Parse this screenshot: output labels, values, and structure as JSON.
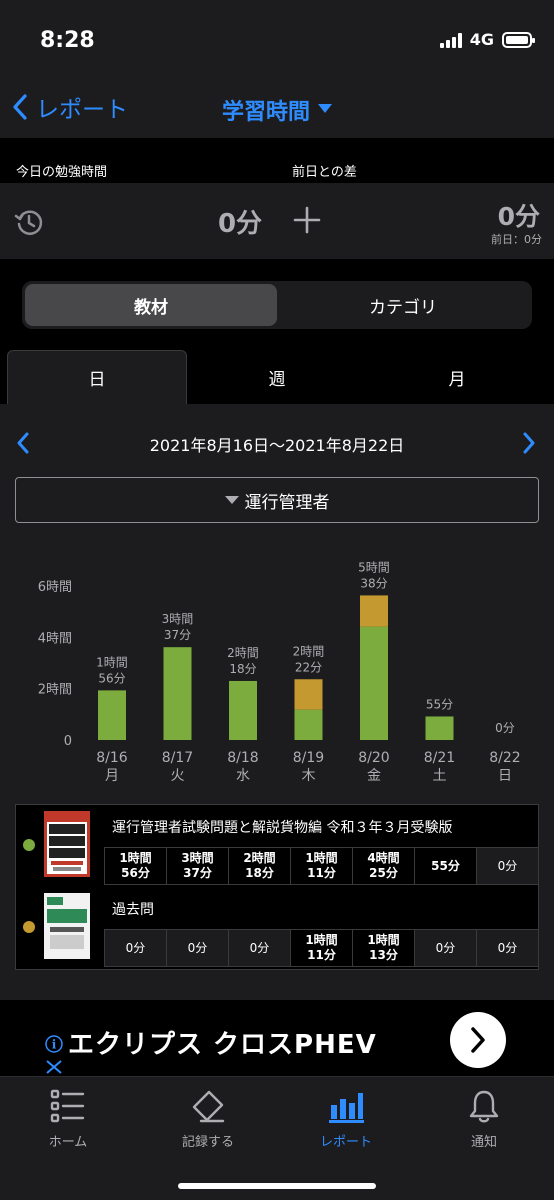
{
  "status": {
    "time": "8:28",
    "network": "4G"
  },
  "nav": {
    "back_label": "レポート",
    "title": "学習時間"
  },
  "summary": {
    "today_label": "今日の勉強時間",
    "diff_label": "前日との差",
    "today_value": "0分",
    "diff_value": "0分",
    "prev_value": "前日：0分"
  },
  "segment": {
    "materials": "教材",
    "category": "カテゴリ"
  },
  "tabs": {
    "day": "日",
    "week": "週",
    "month": "月"
  },
  "range": "2021年8月16日〜2021年8月22日",
  "filter": "運行管理者",
  "chart_data": {
    "type": "bar",
    "stacked": true,
    "categories": [
      "8/16",
      "8/17",
      "8/18",
      "8/19",
      "8/20",
      "8/21",
      "8/22"
    ],
    "weekdays": [
      "月",
      "火",
      "水",
      "木",
      "金",
      "土",
      "日"
    ],
    "series": [
      {
        "color": "#7cab3e",
        "values": [
          116,
          217,
          138,
          71,
          265,
          55,
          0
        ]
      },
      {
        "color": "#c49a30",
        "values": [
          0,
          0,
          0,
          71,
          73,
          0,
          0
        ]
      }
    ],
    "totals_label": [
      [
        "1時間",
        "56分"
      ],
      [
        "3時間",
        "37分"
      ],
      [
        "2時間",
        "18分"
      ],
      [
        "2時間",
        "22分"
      ],
      [
        "5時間",
        "38分"
      ],
      [
        "",
        "55分"
      ],
      [
        "",
        "0分"
      ]
    ],
    "y_ticks": [
      {
        "value": 0,
        "label": "0"
      },
      {
        "value": 120,
        "label": "2時間"
      },
      {
        "value": 240,
        "label": "4時間"
      },
      {
        "value": 360,
        "label": "6時間"
      }
    ],
    "ylim": [
      0,
      360
    ],
    "unit": "minutes"
  },
  "materials": [
    {
      "title": "運行管理者試験問題と解説貨物編 令和３年３月受験版",
      "color": "#7cab3e",
      "cells": [
        [
          "1時間",
          "56分"
        ],
        [
          "3時間",
          "37分"
        ],
        [
          "2時間",
          "18分"
        ],
        [
          "1時間",
          "11分"
        ],
        [
          "4時間",
          "25分"
        ],
        [
          "",
          "55分"
        ],
        [
          "",
          "0分"
        ]
      ],
      "highlight": [
        true,
        true,
        true,
        true,
        true,
        true,
        false
      ],
      "thumb_text": [
        "運行",
        "管理者",
        "試験",
        "問題と解説"
      ]
    },
    {
      "title": "過去問",
      "color": "#c49a30",
      "cells": [
        [
          "",
          "0分"
        ],
        [
          "",
          "0分"
        ],
        [
          "",
          "0分"
        ],
        [
          "1時間",
          "11分"
        ],
        [
          "1時間",
          "13分"
        ],
        [
          "",
          "0分"
        ],
        [
          "",
          "0分"
        ]
      ],
      "highlight": [
        false,
        false,
        false,
        true,
        true,
        false,
        false
      ]
    }
  ],
  "ad": {
    "text": "エクリプス クロスPHEV"
  },
  "tabbar": {
    "home": "ホーム",
    "record": "記録する",
    "report": "レポート",
    "notify": "通知"
  }
}
